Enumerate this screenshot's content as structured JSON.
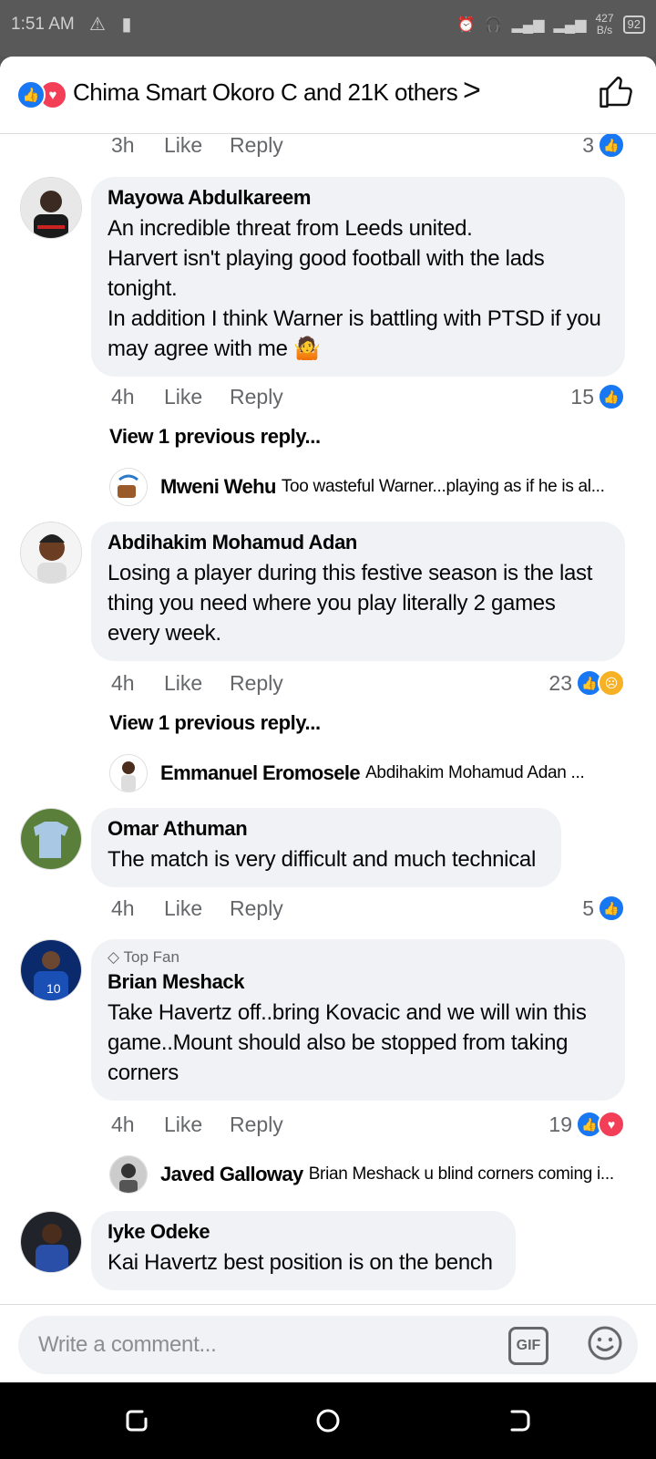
{
  "status_bar": {
    "time": "1:51 AM",
    "left_icons": "⚠ ▮",
    "net_speed_top": "427",
    "net_speed_bottom": "B/s",
    "battery": "92"
  },
  "header": {
    "reactors_text": "Chima Smart Okoro C and 21K others",
    "chevron": ">"
  },
  "top_meta": {
    "time": "3h",
    "like": "Like",
    "reply": "Reply",
    "count": "3"
  },
  "comments": [
    {
      "name": "Mayowa Abdulkareem",
      "text": "An incredible threat from Leeds united.\nHarvert isn't playing good football with the lads tonight.\nIn addition I think Warner is battling with PTSD if you may agree with me 🤷",
      "time": "4h",
      "like": "Like",
      "reply": "Reply",
      "count": "15",
      "view_previous": "View 1 previous reply...",
      "reply_preview": {
        "name": "Mweni Wehu",
        "text": "Too wasteful Warner...playing as if he is al..."
      }
    },
    {
      "name": "Abdihakim Mohamud Adan",
      "text": "Losing a player during this festive season is the last thing you need where you play literally 2 games every week.",
      "time": "4h",
      "like": "Like",
      "reply": "Reply",
      "count": "23",
      "view_previous": "View 1 previous reply...",
      "reply_preview": {
        "name": "Emmanuel Eromosele",
        "text": "Abdihakim Mohamud Adan ..."
      }
    },
    {
      "name": "Omar Athuman",
      "text": "The match is very difficult and much technical",
      "time": "4h",
      "like": "Like",
      "reply": "Reply",
      "count": "5"
    },
    {
      "badge": "Top Fan",
      "name": "Brian Meshack",
      "text": "Take Havertz off..bring Kovacic and we will win this game..Mount should also be stopped from taking corners",
      "time": "4h",
      "like": "Like",
      "reply": "Reply",
      "count": "19",
      "reply_preview": {
        "name": "Javed Galloway",
        "text": "Brian Meshack u blind corners coming i..."
      }
    },
    {
      "name": "Iyke Odeke",
      "text": "Kai Havertz best position is on the bench"
    }
  ],
  "composer": {
    "placeholder": "Write a comment...",
    "gif": "GIF"
  },
  "colors": {
    "like_blue": "#1877f2",
    "love_red": "#f33e58",
    "bubble_bg": "#f0f2f5"
  }
}
